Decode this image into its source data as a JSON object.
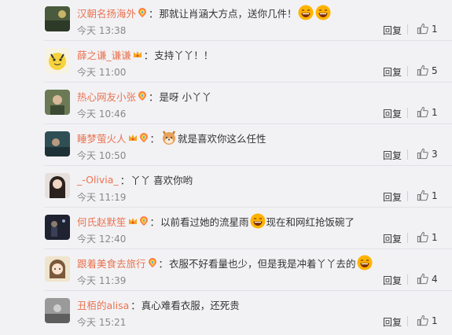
{
  "comments": [
    {
      "username": "汉朝名扬海外",
      "badges": [
        "rainbow-badge"
      ],
      "segments": [
        {
          "type": "text",
          "value": "那就让肖涵大方点，送你几件！"
        },
        {
          "type": "emoji",
          "icon": "laughing-emoji"
        },
        {
          "type": "emoji",
          "icon": "laughing-emoji"
        }
      ],
      "time": "今天 13:38",
      "reply_label": "回复",
      "like_count": "1",
      "avatar": "dark-landscape-avatar"
    },
    {
      "username": "薛之谦_谦谦",
      "badges": [
        "crown-badge"
      ],
      "segments": [
        {
          "type": "text",
          "value": "支持丫丫！！"
        }
      ],
      "time": "今天 11:00",
      "reply_label": "回复",
      "like_count": "5",
      "avatar": "yellow-cartoon-avatar"
    },
    {
      "username": "热心网友小张",
      "badges": [
        "rainbow-badge"
      ],
      "segments": [
        {
          "type": "text",
          "value": "是呀 小丫丫"
        }
      ],
      "time": "今天 10:46",
      "reply_label": "回复",
      "like_count": "1",
      "avatar": "green-photo-avatar"
    },
    {
      "username": "睡梦萤火人",
      "badges": [
        "crown-badge",
        "rainbow-badge"
      ],
      "segments": [
        {
          "type": "emoji",
          "icon": "shiba-dog-emoji"
        },
        {
          "type": "text",
          "value": "就是喜欢你这么任性"
        }
      ],
      "time": "今天 10:50",
      "reply_label": "回复",
      "like_count": "3",
      "avatar": "teal-photo-avatar"
    },
    {
      "username": "_-Olivia_",
      "badges": [],
      "segments": [
        {
          "type": "text",
          "value": "丫丫 喜欢你哟"
        }
      ],
      "time": "今天 11:19",
      "reply_label": "回复",
      "like_count": "1",
      "avatar": "girl-photo-avatar"
    },
    {
      "username": "何氏赵默笙",
      "badges": [
        "crown-badge",
        "rainbow-badge"
      ],
      "segments": [
        {
          "type": "text",
          "value": "以前看过她的流星雨"
        },
        {
          "type": "emoji",
          "icon": "laughing-emoji"
        },
        {
          "type": "text",
          "value": "现在和网红抢饭碗了"
        }
      ],
      "time": "今天 12:40",
      "reply_label": "回复",
      "like_count": "1",
      "avatar": "dark-stage-avatar"
    },
    {
      "username": "跟着美食去旅行",
      "badges": [
        "rainbow-badge"
      ],
      "segments": [
        {
          "type": "text",
          "value": "衣服不好看量也少，但是我是冲着丫丫去的"
        },
        {
          "type": "emoji",
          "icon": "laughing-emoji"
        }
      ],
      "time": "今天 11:39",
      "reply_label": "回复",
      "like_count": "4",
      "avatar": "cartoon-girl-avatar"
    },
    {
      "username": "丑栢的alisa",
      "badges": [],
      "segments": [
        {
          "type": "text",
          "value": "真心难看衣服，还死贵"
        }
      ],
      "time": "今天 15:21",
      "reply_label": "回复",
      "like_count": "1",
      "avatar": "grey-street-avatar"
    }
  ],
  "icons": {
    "like": "thumbs-up-icon"
  },
  "colors": {
    "username": "#eb7350",
    "time": "#888888",
    "background": "#f2f2f5",
    "separator": "#e2e2e6"
  }
}
